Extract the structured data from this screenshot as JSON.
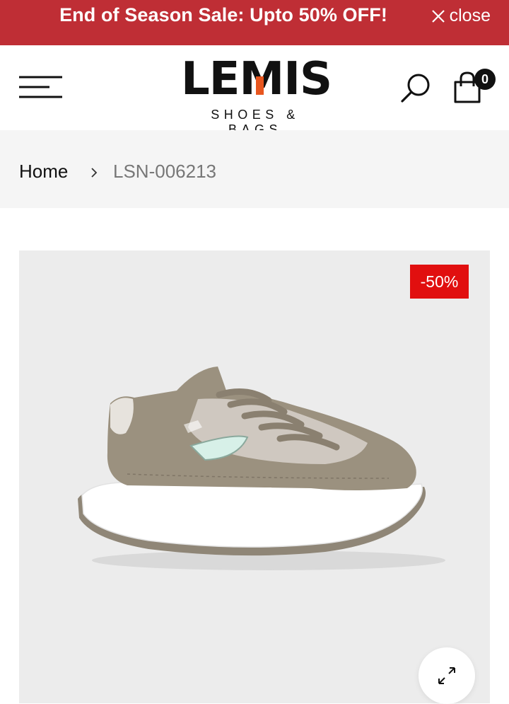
{
  "announcement": {
    "text": "End of Season Sale: Upto 50% OFF!",
    "close_label": "close",
    "background": "#bf2e35"
  },
  "header": {
    "logo_text": "LEMIS",
    "logo_tagline": "SHOES & BAGS",
    "logo_accent_color": "#e8561f",
    "menu_icon": "hamburger-icon",
    "search_icon": "search-icon",
    "cart_icon": "shopping-bag-icon",
    "cart_count": "0"
  },
  "breadcrumb": {
    "home": "Home",
    "separator_icon": "chevron-right-icon",
    "current": "LSN-006213"
  },
  "product": {
    "discount_badge": "-50%",
    "badge_color": "#e10f0f",
    "zoom_icon": "expand-icon",
    "image_alt_icon": "sneaker-image"
  }
}
